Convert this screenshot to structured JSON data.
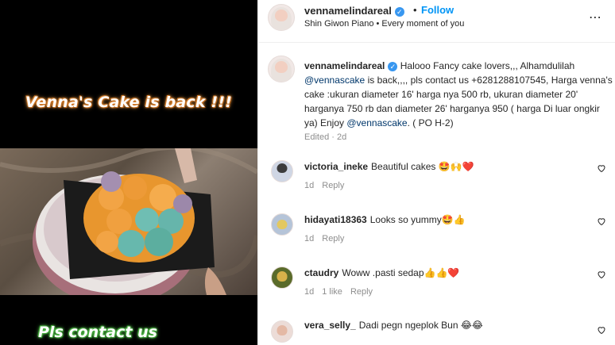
{
  "media": {
    "overlay_top": "Venna's Cake is back !!!",
    "overlay_bottom": "Pls contact us"
  },
  "header": {
    "username": "vennamelindareal",
    "separator": "•",
    "follow_label": "Follow",
    "music": "Shin Giwon Piano • Every moment of you",
    "more_icon": "⋯"
  },
  "caption": {
    "username": "vennamelindareal",
    "text_1": " Halooo Fancy cake lovers,,, Alhamdulilah ",
    "mention_1": "@vennascake",
    "text_2": " is back,,,, pls contact us +6281288107545, Harga venna's cake :ukuran diameter 16' harga nya 500 rb, ukuran diameter 20' harganya 750 rb dan diameter 26' harganya 950 ( harga Di luar ongkir ya) Enjoy ",
    "mention_2": "@vennascake",
    "text_3": ". ( PO H-2)",
    "edited": "Edited · 2d"
  },
  "comments": [
    {
      "username": "victoria_ineke",
      "text": "Beautiful cakes",
      "emoji": "🤩🙌❤️",
      "age": "1d",
      "likes": "",
      "reply": "Reply"
    },
    {
      "username": "hidayati18363",
      "text": "Looks so yummy",
      "emoji": "🤩👍",
      "age": "1d",
      "likes": "",
      "reply": "Reply"
    },
    {
      "username": "ctaudry",
      "text": "Woww .pasti sedap",
      "emoji": "👍👍❤️",
      "age": "1d",
      "likes": "1 like",
      "reply": "Reply"
    },
    {
      "username": "vera_selly_",
      "text": "Dadi pegn ngeplok Bun",
      "emoji": "😂😂",
      "age": "",
      "likes": "",
      "reply": ""
    }
  ],
  "colors": {
    "accent": "#0095f6",
    "verified": "#3897f0",
    "text": "#262626",
    "muted": "#8e8e8e",
    "mention": "#00376b"
  }
}
